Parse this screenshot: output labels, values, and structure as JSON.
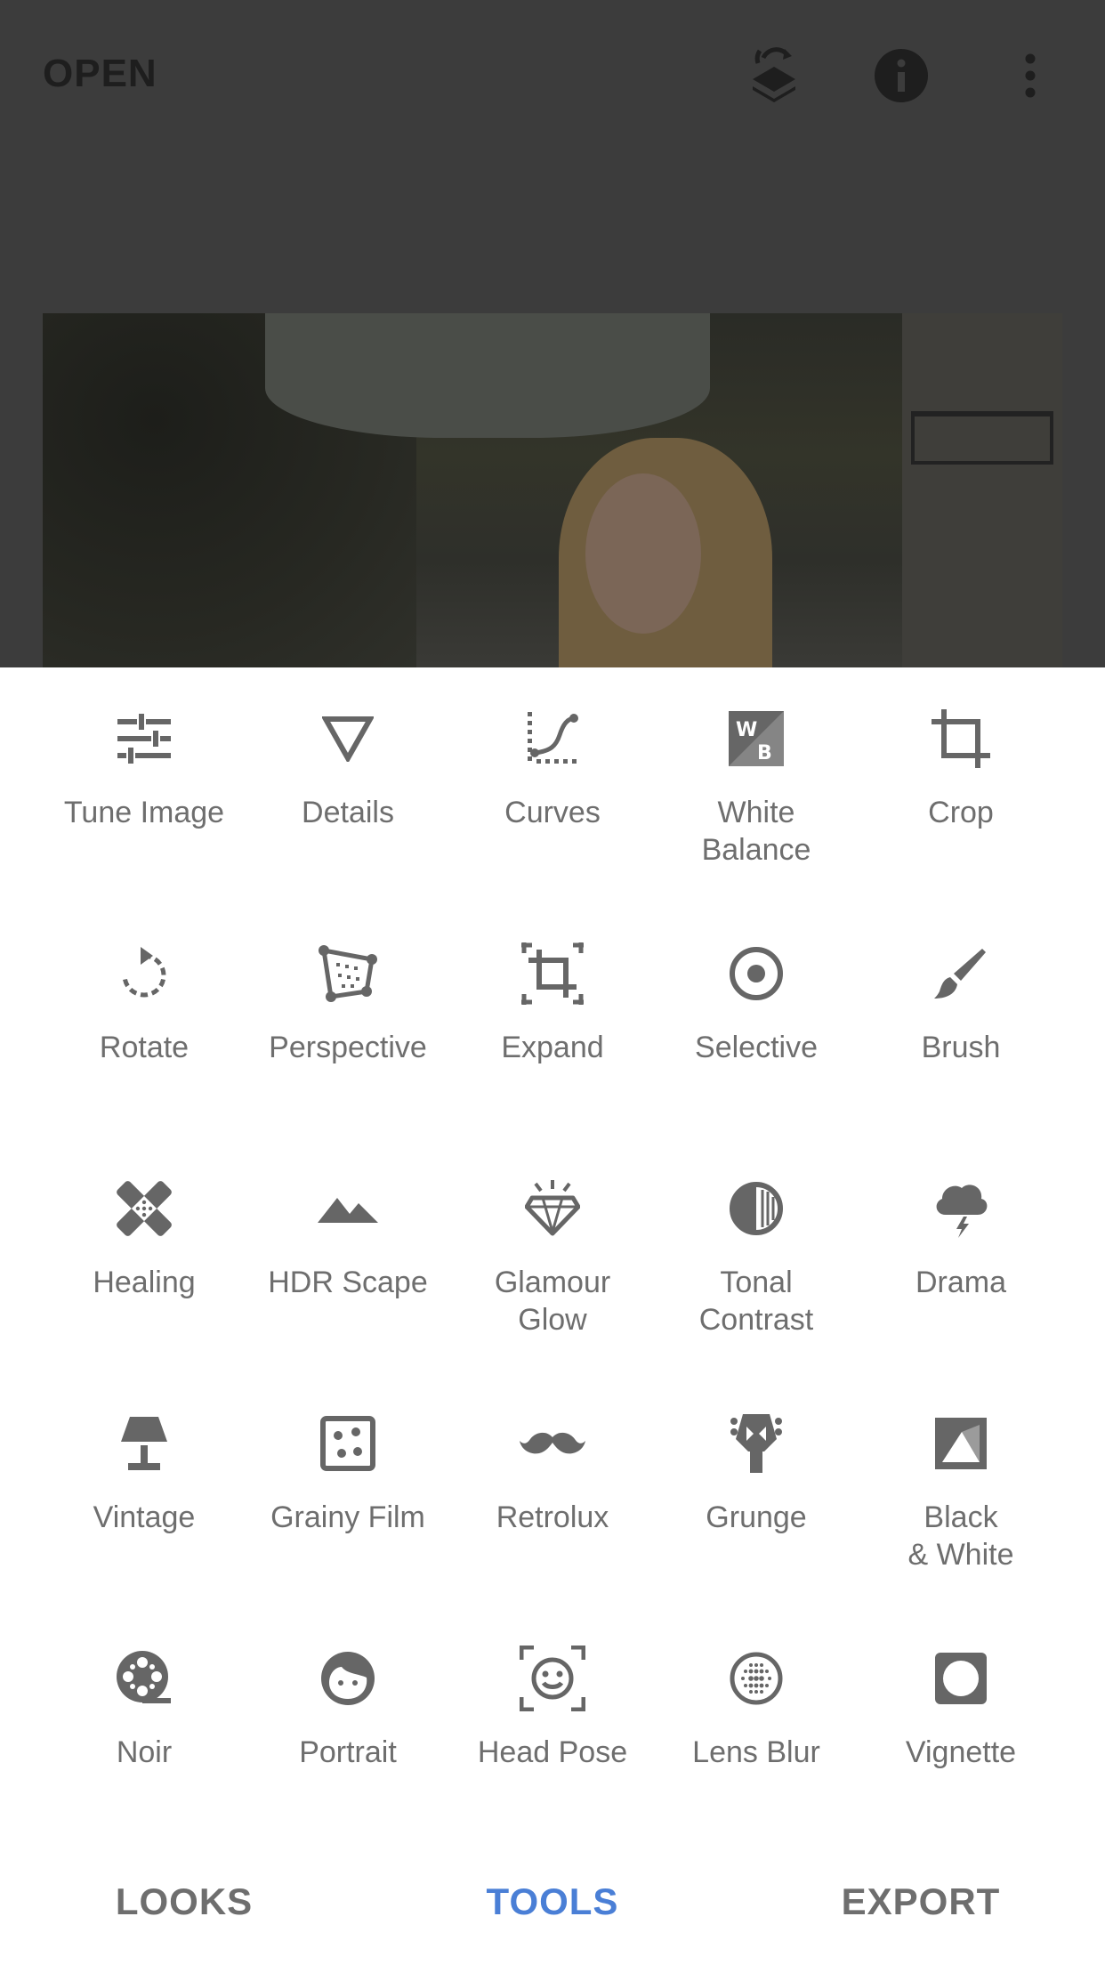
{
  "top_bar": {
    "open_label": "OPEN",
    "icons": [
      "layers-stack-icon",
      "info-icon",
      "more-vert-icon"
    ]
  },
  "tools": [
    {
      "label": "Tune Image",
      "icon": "sliders-icon"
    },
    {
      "label": "Details",
      "icon": "triangle-icon"
    },
    {
      "label": "Curves",
      "icon": "curve-icon"
    },
    {
      "label": "White\nBalance",
      "icon": "white-balance-icon"
    },
    {
      "label": "Crop",
      "icon": "crop-icon"
    },
    {
      "label": "Rotate",
      "icon": "rotate-icon"
    },
    {
      "label": "Perspective",
      "icon": "perspective-icon"
    },
    {
      "label": "Expand",
      "icon": "expand-icon"
    },
    {
      "label": "Selective",
      "icon": "target-icon"
    },
    {
      "label": "Brush",
      "icon": "brush-icon"
    },
    {
      "label": "Healing",
      "icon": "bandage-icon"
    },
    {
      "label": "HDR Scape",
      "icon": "mountains-icon"
    },
    {
      "label": "Glamour\nGlow",
      "icon": "diamond-icon"
    },
    {
      "label": "Tonal\nContrast",
      "icon": "contrast-icon"
    },
    {
      "label": "Drama",
      "icon": "storm-cloud-icon"
    },
    {
      "label": "Vintage",
      "icon": "lamp-icon"
    },
    {
      "label": "Grainy Film",
      "icon": "film-grain-icon"
    },
    {
      "label": "Retrolux",
      "icon": "mustache-icon"
    },
    {
      "label": "Grunge",
      "icon": "guitar-head-icon"
    },
    {
      "label": "Black\n& White",
      "icon": "black-white-icon"
    },
    {
      "label": "Noir",
      "icon": "film-reel-icon"
    },
    {
      "label": "Portrait",
      "icon": "face-icon"
    },
    {
      "label": "Head Pose",
      "icon": "face-frame-icon"
    },
    {
      "label": "Lens Blur",
      "icon": "lens-blur-icon"
    },
    {
      "label": "Vignette",
      "icon": "vignette-icon"
    }
  ],
  "bottom_nav": {
    "looks": "LOOKS",
    "tools": "TOOLS",
    "export": "EXPORT",
    "active": "tools"
  },
  "colors": {
    "accent": "#4a7fd6",
    "icon": "#666666",
    "label": "#6e6e6e",
    "dim_overlay": "#3c3c3c"
  }
}
